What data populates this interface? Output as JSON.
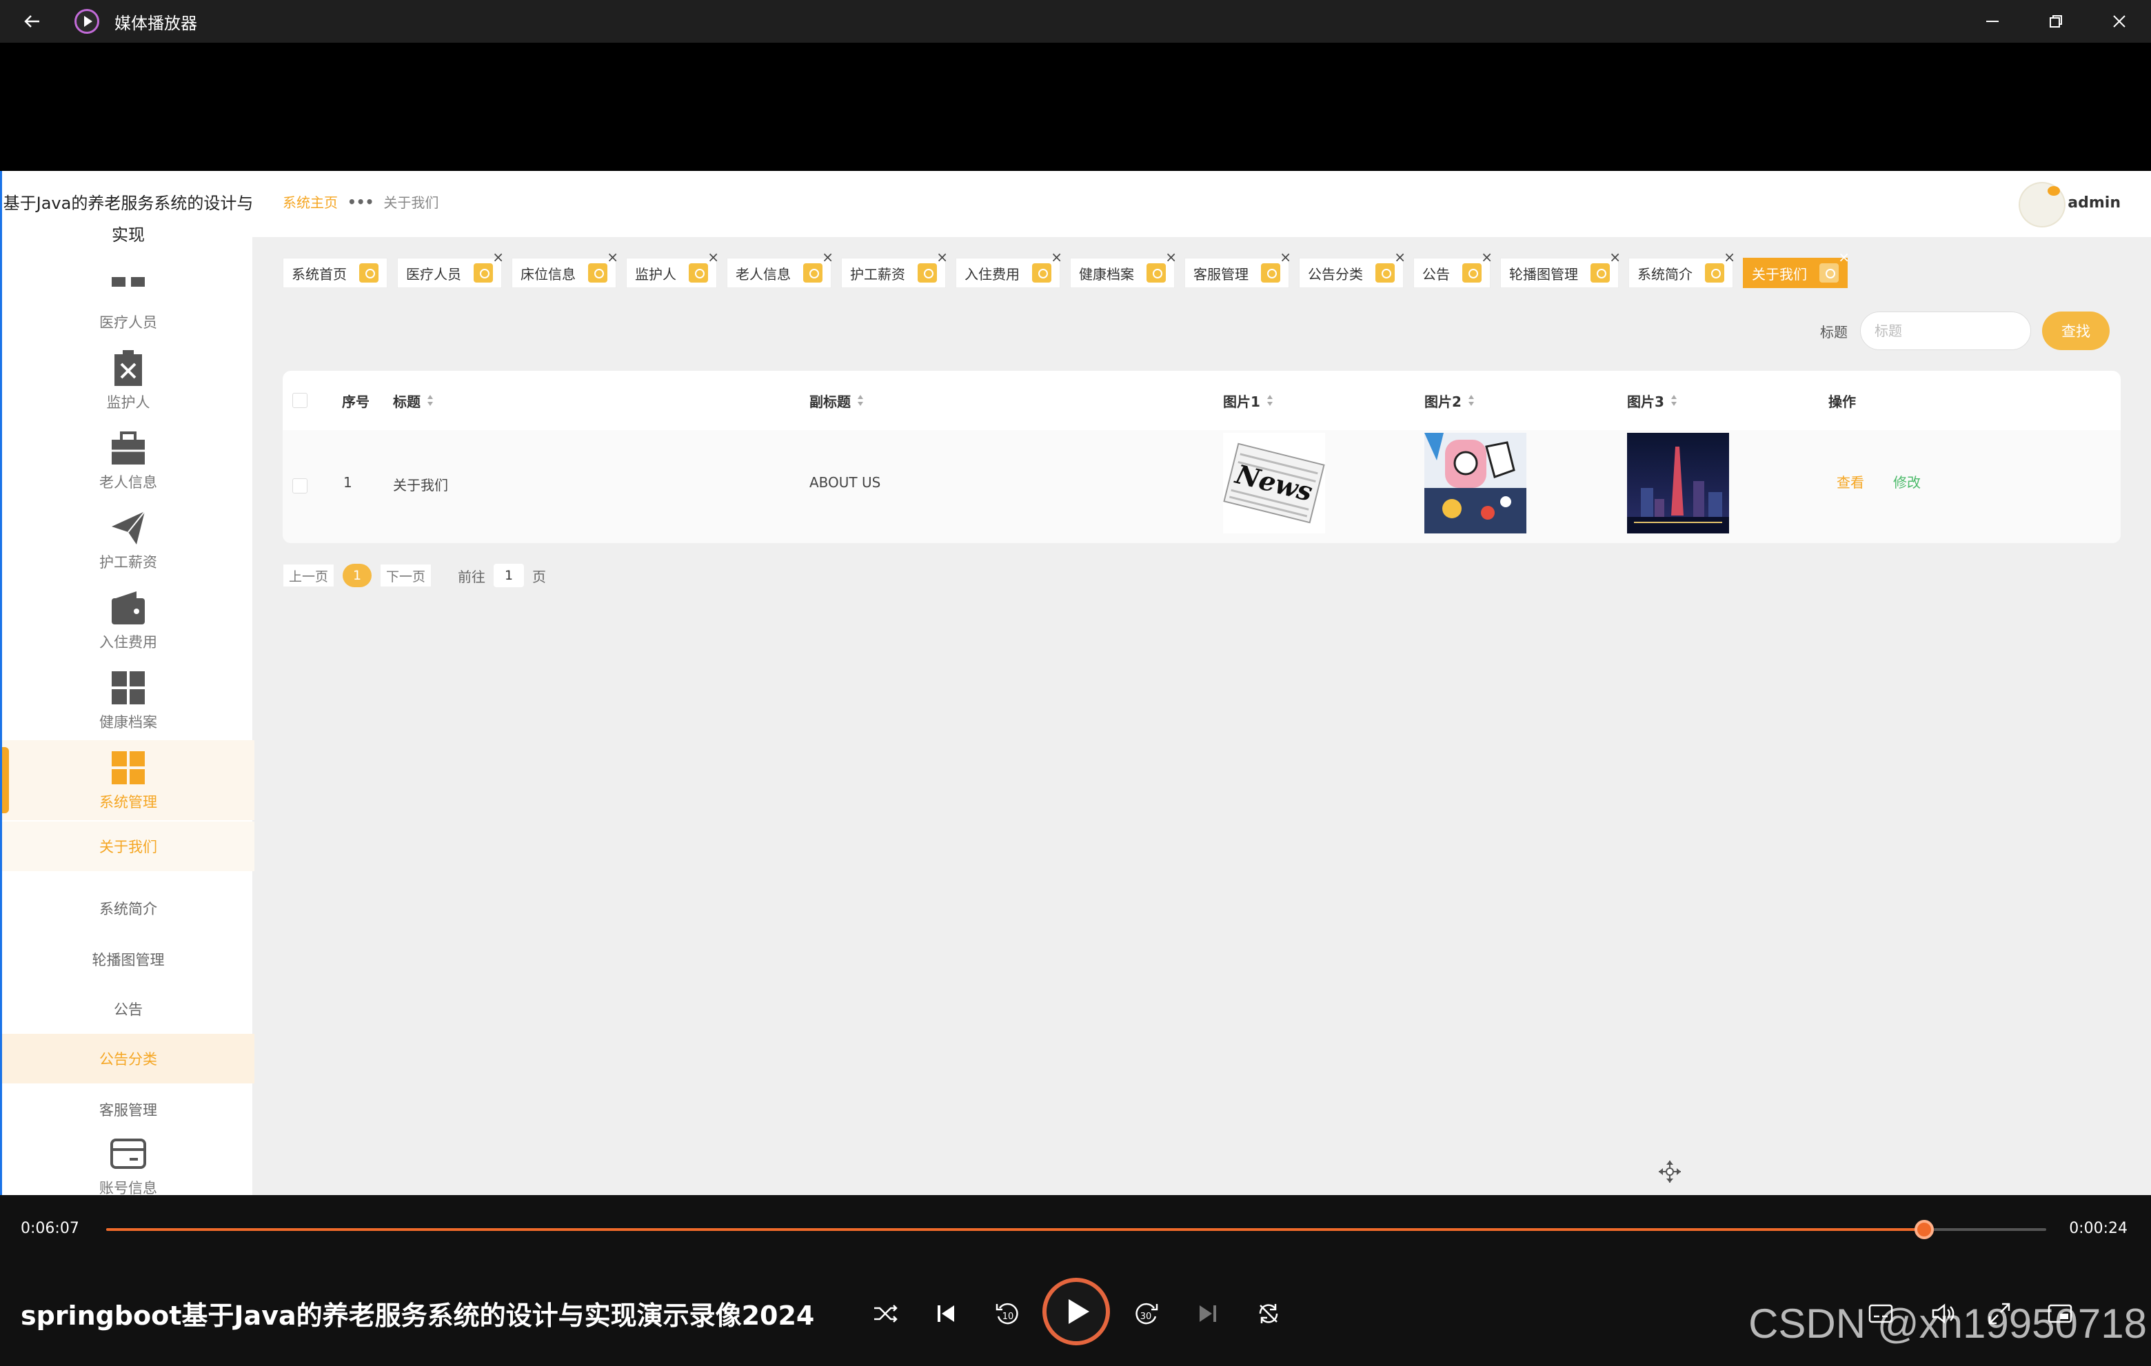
{
  "window": {
    "title": "媒体播放器"
  },
  "app": {
    "sidebar": {
      "title": "基于Java的养老服务系统的设计与实现",
      "items": [
        {
          "label": "医疗人员",
          "icon": "grid-icon"
        },
        {
          "label": "监护人",
          "icon": "clipboard-x-icon"
        },
        {
          "label": "老人信息",
          "icon": "briefcase-icon"
        },
        {
          "label": "护工薪资",
          "icon": "paper-plane-icon"
        },
        {
          "label": "入住费用",
          "icon": "wallet-icon"
        },
        {
          "label": "健康档案",
          "icon": "apps-icon"
        },
        {
          "label": "系统管理",
          "icon": "apps-icon"
        }
      ],
      "sub_items": [
        "关于我们",
        "系统简介",
        "轮播图管理",
        "公告",
        "公告分类",
        "客服管理"
      ],
      "last_item": {
        "label": "账号信息",
        "icon": "card-icon"
      }
    },
    "header": {
      "breadcrumb_home": "系统主页",
      "breadcrumb_current": "关于我们",
      "username": "admin"
    },
    "tags": [
      "系统首页",
      "医疗人员",
      "床位信息",
      "监护人",
      "老人信息",
      "护工薪资",
      "入住费用",
      "健康档案",
      "客服管理",
      "公告分类",
      "公告",
      "轮播图管理",
      "系统简介",
      "关于我们"
    ],
    "search": {
      "label": "标题",
      "placeholder": "标题",
      "button": "查找"
    },
    "table": {
      "columns": [
        "序号",
        "标题",
        "副标题",
        "图片1",
        "图片2",
        "图片3",
        "操作"
      ],
      "rows": [
        {
          "index": "1",
          "title": "关于我们",
          "subtitle": "ABOUT US",
          "actions": [
            "查看",
            "修改"
          ]
        }
      ]
    },
    "pager": {
      "prev": "上一页",
      "current": "1",
      "next": "下一页",
      "goto": "前往",
      "goto_value": "1",
      "page_unit": "页"
    }
  },
  "player": {
    "current_time": "0:06:07",
    "total_time": "0:00:24",
    "progress": 0.937,
    "video_title": "springboot基于Java的养老服务系统的设计与实现演示录像2024",
    "watermark": "CSDN @xn19950718",
    "accent": "#f06a2a"
  }
}
